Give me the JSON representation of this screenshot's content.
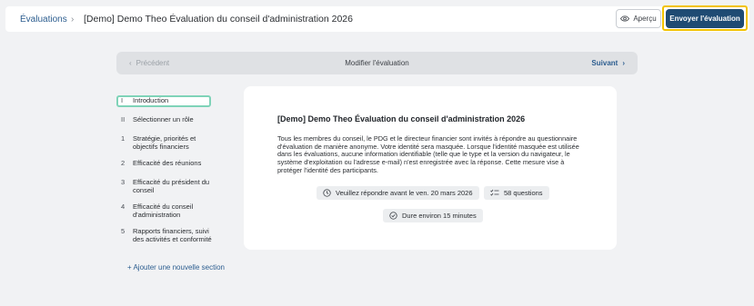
{
  "header": {
    "breadcrumb_link": "Évaluations",
    "breadcrumb_sep": "›",
    "title": "[Demo] Demo Theo Évaluation du conseil d'administration 2026",
    "preview_label": "Aperçu",
    "send_label": "Envoyer l'évaluation"
  },
  "nav": {
    "prev_label": "Précédent",
    "center_label": "Modifier l'évaluation",
    "next_label": "Suivant"
  },
  "sections": [
    {
      "num": "I",
      "label": "Introduction"
    },
    {
      "num": "II",
      "label": "Sélectionner un rôle"
    },
    {
      "num": "1",
      "label": "Stratégie, priorités et objectifs financiers"
    },
    {
      "num": "2",
      "label": "Efficacité des réunions"
    },
    {
      "num": "3",
      "label": "Efficacité du président du conseil"
    },
    {
      "num": "4",
      "label": "Efficacité du conseil d'administration"
    },
    {
      "num": "5",
      "label": "Rapports financiers, suivi des activités et conformité"
    }
  ],
  "add_section_label": "+ Ajouter une nouvelle section",
  "card": {
    "title": "[Demo] Demo Theo Évaluation du conseil d'administration 2026",
    "description": "Tous les membres du conseil, le PDG et le directeur financier sont invités à répondre au questionnaire d'évaluation de manière anonyme. Votre identité sera masquée. Lorsque l'identité masquée est utilisée dans les évaluations, aucune information identifiable (telle que le type et la version du navigateur, le système d'exploitation ou l'adresse e-mail) n'est enregistrée avec la réponse. Cette mesure vise à protéger l'identité des participants.",
    "deadline": "Veuillez répondre avant le ven. 20 mars 2026",
    "questions": "58 questions",
    "duration": "Dure environ 15 minutes"
  },
  "colors": {
    "primary": "#1f4b73",
    "link": "#2c5d8f",
    "highlight": "#f2c200",
    "active_outline": "#7fd3b8"
  }
}
